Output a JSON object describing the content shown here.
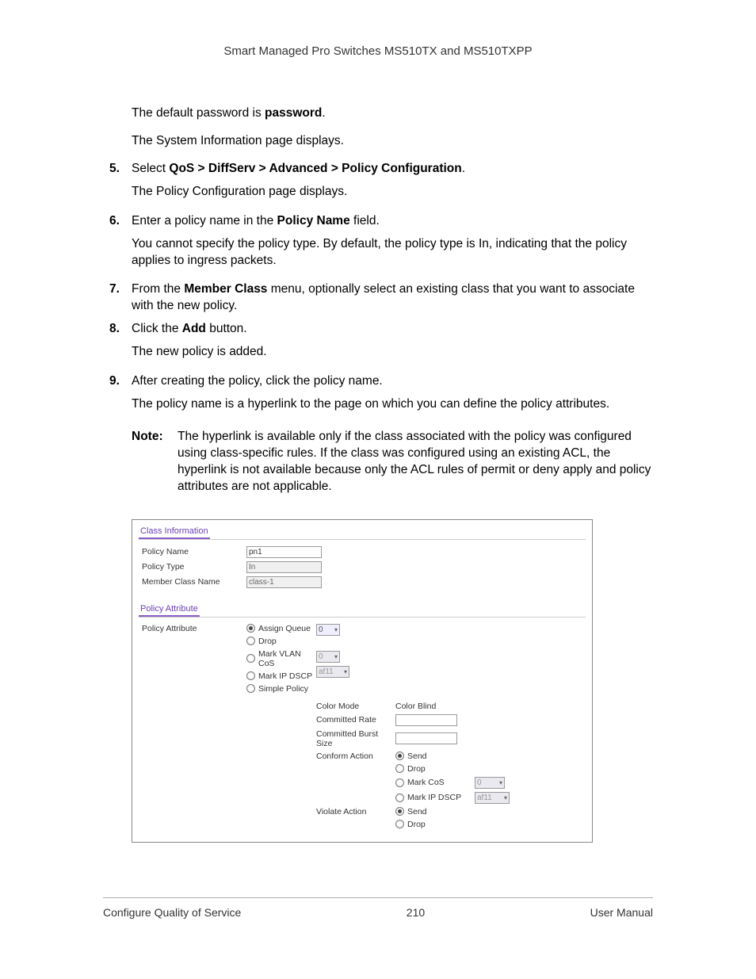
{
  "header": "Smart Managed Pro Switches MS510TX and MS510TXPP",
  "intro": {
    "line1_a": "The default password is ",
    "line1_b": "password",
    "line1_c": ".",
    "line2": "The System Information page displays."
  },
  "steps": {
    "s5_a": "Select ",
    "s5_b": "QoS > DiffServ > Advanced > Policy Configuration",
    "s5_c": ".",
    "s5_follow": "The Policy Configuration page displays.",
    "s6_a": "Enter a policy name in the ",
    "s6_b": "Policy Name",
    "s6_c": " field.",
    "s6_follow": "You cannot specify the policy type. By default, the policy type is In, indicating that the policy applies to ingress packets.",
    "s7_a": "From the ",
    "s7_b": "Member Class",
    "s7_c": " menu, optionally select an existing class that you want to associate with the new policy.",
    "s8_a": "Click the ",
    "s8_b": "Add",
    "s8_c": " button.",
    "s8_follow": "The new policy is added.",
    "s9": "After creating the policy, click the policy name.",
    "s9_follow": "The policy name is a hyperlink to the page on which you can define the policy attributes."
  },
  "note": {
    "label": "Note:",
    "text": "The hyperlink is available only if the class associated with the policy was configured using class-specific rules. If the class was configured using an existing ACL, the hyperlink is not available because only the ACL rules of permit or deny apply and policy attributes are not applicable."
  },
  "figure": {
    "section1": "Class Information",
    "policy_name_label": "Policy Name",
    "policy_name_value": "pn1",
    "policy_type_label": "Policy Type",
    "policy_type_value": "In",
    "member_class_label": "Member Class Name",
    "member_class_value": "class-1",
    "section2": "Policy Attribute",
    "attr_label": "Policy Attribute",
    "radios": {
      "assign_queue": "Assign Queue",
      "assign_queue_val": "0",
      "drop": "Drop",
      "mark_vlan": "Mark VLAN CoS",
      "mark_vlan_val": "0",
      "mark_ip": "Mark IP DSCP",
      "mark_ip_val": "af11",
      "simple": "Simple Policy"
    },
    "simple": {
      "color_mode": "Color Mode",
      "color_mode_val": "Color Blind",
      "committed_rate": "Committed Rate",
      "committed_burst": "Committed Burst Size",
      "conform": "Conform Action",
      "violate": "Violate Action",
      "send": "Send",
      "drop": "Drop",
      "mark_cos": "Mark CoS",
      "mark_cos_val": "0",
      "mark_ip": "Mark IP DSCP",
      "mark_ip_val": "af11"
    }
  },
  "footer": {
    "left": "Configure Quality of Service",
    "center": "210",
    "right": "User Manual"
  }
}
